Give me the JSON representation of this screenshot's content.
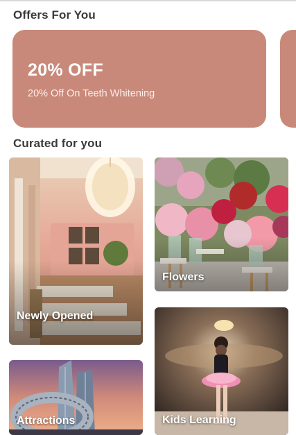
{
  "offers": {
    "title": "Offers For You",
    "cards": [
      {
        "title": "20% OFF",
        "subtitle": "20% Off On Teeth Whitening",
        "color": "#c9897a"
      }
    ]
  },
  "curated": {
    "title": "Curated for you",
    "tiles": [
      {
        "label": "Newly Opened",
        "image": "restaurant-interior"
      },
      {
        "label": "Flowers",
        "image": "flower-shop"
      },
      {
        "label": "Attractions",
        "image": "city-landmark"
      },
      {
        "label": "Kids Learning",
        "image": "ballet-stage"
      }
    ]
  },
  "colors": {
    "offer_card": "#c9897a",
    "text": "#3a3a3a",
    "background": "#ffffff"
  }
}
